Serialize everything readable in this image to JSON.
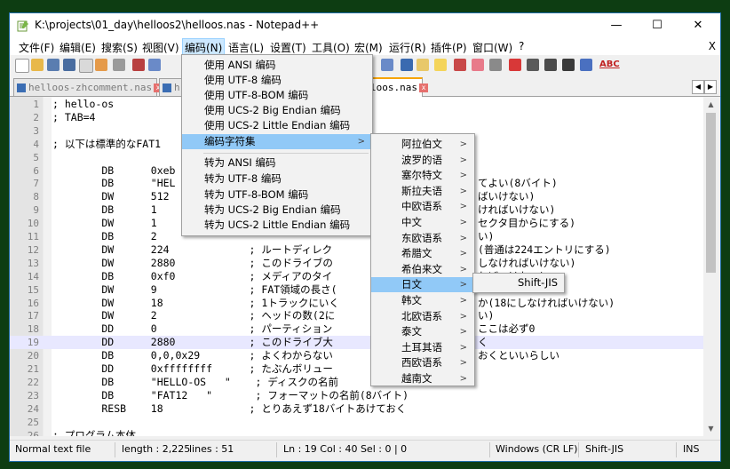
{
  "window": {
    "title": "K:\\projects\\01_day\\helloos2\\helloos.nas - Notepad++",
    "minimize": "—",
    "maximize": "☐",
    "close": "✕"
  },
  "menubar": {
    "items": [
      "文件(F)",
      "编辑(E)",
      "搜索(S)",
      "视图(V)",
      "编码(N)",
      "语言(L)",
      "设置(T)",
      "工具(O)",
      "宏(M)",
      "运行(R)",
      "插件(P)",
      "窗口(W)",
      "?"
    ],
    "close_label": "X"
  },
  "toolbar": {
    "icons": [
      "new-icon",
      "open-icon",
      "save-icon",
      "save-all-icon",
      "close-icon",
      "close-all-icon",
      "print-icon",
      "cut-icon",
      "word-wrap-icon",
      "show-all-icon",
      "indent-guide-icon",
      "doc-map-icon",
      "function-list-icon",
      "folder-workspace-icon",
      "monitor-icon",
      "record-macro-icon",
      "stop-record-icon",
      "play-macro-icon",
      "run-macro-icon",
      "save-macro-icon",
      "spellcheck-icon"
    ],
    "spell_label": "ABC"
  },
  "tabs": [
    {
      "label": "helloos-zhcomment.nas",
      "active": false
    },
    {
      "label": "h",
      "active": false
    },
    {
      "label": "loos.nas",
      "active": true
    }
  ],
  "editor": {
    "current_line": 19,
    "lines": [
      {
        "n": "1",
        "text": "; hello-os"
      },
      {
        "n": "2",
        "text": "; TAB=4"
      },
      {
        "n": "3",
        "text": ""
      },
      {
        "n": "4",
        "text": "; 以下は標準的なFAT1"
      },
      {
        "n": "5",
        "text": ""
      },
      {
        "n": "6",
        "text": "        DB      0xeb"
      },
      {
        "n": "7",
        "text": "        DB      \"HEL"
      },
      {
        "n": "8",
        "text": "        DW      512"
      },
      {
        "n": "9",
        "text": "        DB      1"
      },
      {
        "n": "10",
        "text": "        DW      1"
      },
      {
        "n": "11",
        "text": "        DB      2"
      },
      {
        "n": "12",
        "text": "        DW      224             ; ルートディレク"
      },
      {
        "n": "13",
        "text": "        DW      2880            ; このドライブの"
      },
      {
        "n": "14",
        "text": "        DB      0xf0            ; メディアのタイ"
      },
      {
        "n": "15",
        "text": "        DW      9               ; FAT領域の長さ("
      },
      {
        "n": "16",
        "text": "        DW      18              ; 1トラックにいく"
      },
      {
        "n": "17",
        "text": "        DW      2               ; ヘッドの数(2に"
      },
      {
        "n": "18",
        "text": "        DD      0               ; パーティション"
      },
      {
        "n": "19",
        "text": "        DD      2880            ; このドライブ大"
      },
      {
        "n": "20",
        "text": "        DB      0,0,0x29        ; よくわからない"
      },
      {
        "n": "21",
        "text": "        DD      0xffffffff      ; たぶんボリュー"
      },
      {
        "n": "22",
        "text": "        DB      \"HELLO-OS   \"    ; ディスクの名前"
      },
      {
        "n": "23",
        "text": "        DB      \"FAT12   \"       ; フォーマットの名前(8バイト)"
      },
      {
        "n": "24",
        "text": "        RESB    18              ; とりあえず18バイトあけておく"
      },
      {
        "n": "25",
        "text": ""
      },
      {
        "n": "26",
        "text": "; プログラム本体"
      }
    ],
    "right_fragments": [
      {
        "line": 7,
        "text": "てよい(8バイト)"
      },
      {
        "line": 8,
        "text": "ばいけない)"
      },
      {
        "line": 9,
        "text": "ければいけない)"
      },
      {
        "line": 10,
        "text": "セクタ目からにする)"
      },
      {
        "line": 11,
        "text": "い)"
      },
      {
        "line": 12,
        "text": "(普通は224エントリにする)"
      },
      {
        "line": 13,
        "text": "しなければいけない)"
      },
      {
        "line": 14,
        "text": "ればいけない)"
      },
      {
        "line": 16,
        "text": "か(18にしなければいけない)"
      },
      {
        "line": 17,
        "text": "い)"
      },
      {
        "line": 18,
        "text": "ここは必ず0"
      },
      {
        "line": 19,
        "text": "く"
      },
      {
        "line": 20,
        "text": "おくといいらしい"
      }
    ]
  },
  "encoding_menu": {
    "items": [
      {
        "label": "使用 ANSI 编码"
      },
      {
        "label": "使用 UTF-8 编码"
      },
      {
        "label": "使用 UTF-8-BOM 编码"
      },
      {
        "label": "使用 UCS-2 Big Endian 编码"
      },
      {
        "label": "使用 UCS-2 Little Endian 编码"
      },
      {
        "label": "编码字符集",
        "submenu": true,
        "highlighted": true
      },
      {
        "label": "转为 ANSI 编码"
      },
      {
        "label": "转为 UTF-8 编码"
      },
      {
        "label": "转为 UTF-8-BOM 编码"
      },
      {
        "label": "转为 UCS-2 Big Endian 编码"
      },
      {
        "label": "转为 UCS-2 Little Endian 编码"
      }
    ],
    "arrow": ">"
  },
  "charset_menu": {
    "items": [
      "阿拉伯文",
      "波罗的语",
      "塞尔特文",
      "斯拉夫语",
      "中欧语系",
      "中文",
      "东欧语系",
      "希腊文",
      "希伯来文",
      "日文",
      "韩文",
      "北欧语系",
      "泰文",
      "土耳其语",
      "西欧语系",
      "越南文"
    ],
    "highlighted": "日文"
  },
  "japanese_menu": {
    "items": [
      "Shift-JIS"
    ]
  },
  "status": {
    "file_type": "Normal text file",
    "length": "length : 2,225",
    "lines": "lines : 51",
    "position": "Ln : 19   Col : 40   Sel : 0 | 0",
    "eol": "Windows (CR LF)",
    "encoding": "Shift-JIS",
    "mode": "INS"
  }
}
